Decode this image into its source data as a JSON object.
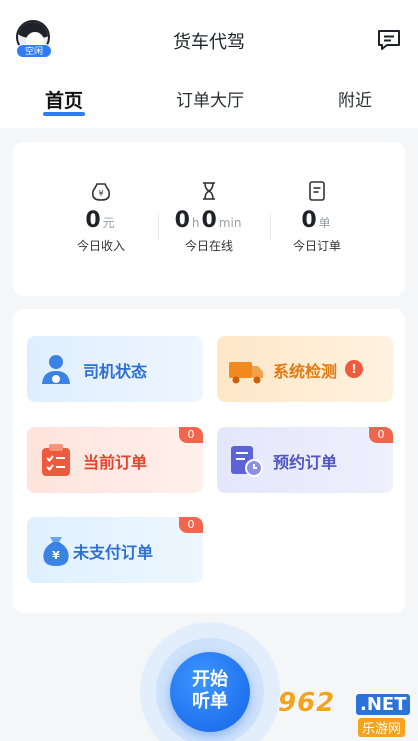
{
  "header": {
    "title": "货车代驾",
    "status_badge": "空闲"
  },
  "tabs": [
    {
      "label": "首页",
      "active": true
    },
    {
      "label": "订单大厅",
      "active": false
    },
    {
      "label": "附近",
      "active": false
    }
  ],
  "stats": {
    "income": {
      "value": "0",
      "unit": "元",
      "label": "今日收入"
    },
    "online": {
      "hours": "0",
      "h_unit": "h",
      "minutes": "0",
      "min_unit": "min",
      "label": "今日在线"
    },
    "orders": {
      "value": "0",
      "unit": "单",
      "label": "今日订单"
    }
  },
  "menu": {
    "driver_status": {
      "label": "司机状态"
    },
    "system_check": {
      "label": "系统检测",
      "alert": "!"
    },
    "current_orders": {
      "label": "当前订单",
      "count": "0"
    },
    "reserved_orders": {
      "label": "预约订单",
      "count": "0"
    },
    "unpaid_orders": {
      "label": "未支付订单",
      "count": "0"
    }
  },
  "listen_button": {
    "line1": "开始",
    "line2": "听单"
  },
  "watermark": {
    "main": "962",
    "net": ".NET",
    "sub": "乐游网"
  },
  "colors": {
    "accent": "#2f7cf6",
    "orange": "#e07a12",
    "red": "#e5452f",
    "purple": "#4f56c4"
  },
  "icons": [
    "message-icon",
    "wallet-icon",
    "hourglass-icon",
    "order-doc-icon",
    "driver-icon",
    "truck-icon",
    "clipboard-icon",
    "reserve-icon",
    "money-bag-icon"
  ]
}
